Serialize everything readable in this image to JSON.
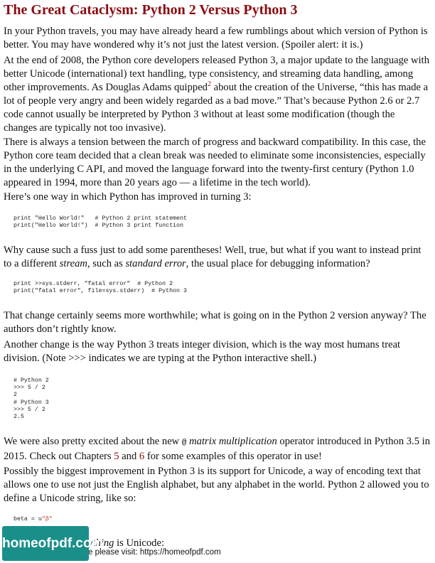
{
  "title": "The Great Cataclysm: Python 2 Versus Python 3",
  "p1": "In your Python travels, you may have already heard a few rumblings about which version of Python is better. You may have wondered why it’s not just the latest version. (Spoiler alert: it is.)",
  "p2_before": "At the end of 2008, the Python core developers released Python 3, a major update to the language with better Unicode (international) text handling, type consistency, and streaming data handling, among other improvements. As Douglas Adams quipped",
  "p2_sup": "2",
  "p2_after": " about the creation of the Universe, “this has made a lot of people very angry and been widely regarded as a bad move.” That’s because Python 2.6 or 2.7 code cannot usually be interpreted by Python 3 without at least some modification (though the changes are typically not too invasive).",
  "p3": "There is always a tension between the march of progress and backward compatibility. In this case, the Python core team decided that a clean break was needed to eliminate some inconsistencies, especially in the underlying C API, and moved the language forward into the twenty-first century (Python 1.0 appeared in 1994, more than 20 years ago — a lifetime in the tech world).",
  "p4": "Here’s one way in which Python has improved in turning 3:",
  "code1": "print \"Hello World!\"   # Python 2 print statement\nprint(\"Hello World!\")  # Python 3 print function",
  "p5_a": "Why cause such a fuss just to add some parentheses! Well, true, but what if you want to instead print to a different ",
  "p5_em1": "stream",
  "p5_b": ", such as ",
  "p5_em2": "standard error",
  "p5_c": ", the usual place for debugging information?",
  "code2": "print >>sys.stderr, \"fatal error\"  # Python 2\nprint(\"fatal error\", file=sys.stderr)  # Python 3",
  "p6": "That change certainly seems more worthwhile; what is going on in the Python 2 version anyway? The authors don’t rightly know.",
  "p7": "Another change is the way Python 3 treats integer division, which is the way most humans treat division. (Note >>> indicates we are typing at the Python interactive shell.)",
  "code3": "# Python 2\n>>> 5 / 2\n2\n# Python 3\n>>> 5 / 2\n2.5",
  "p8_a": "We were also pretty excited about the new ",
  "p8_code": "@",
  "p8_em": " matrix multiplication",
  "p8_b": " operator introduced in Python 3.5 in 2015. Check out Chapters ",
  "p8_ch5": "5",
  "p8_and": " and ",
  "p8_ch6": "6",
  "p8_c": " for some examples of this operator in use!",
  "p9": "Possibly the biggest improvement in Python 3 is its support for Unicode, a way of encoding text that allows one to use not just the English alphabet, but any alphabet in the world. Python 2 allowed you to define a Unicode string, like so:",
  "code4_a": "beta = u",
  "code4_str": "\"β\"",
  "footer_fragment_em": "ything",
  "footer_fragment_rest": " is Unicode:",
  "badge": "homeofpdf.com",
  "footer_note": "e please visit: https://homeofpdf.com",
  "colors": {
    "title": "#8b0b12",
    "badge": "#1a8f8a"
  }
}
